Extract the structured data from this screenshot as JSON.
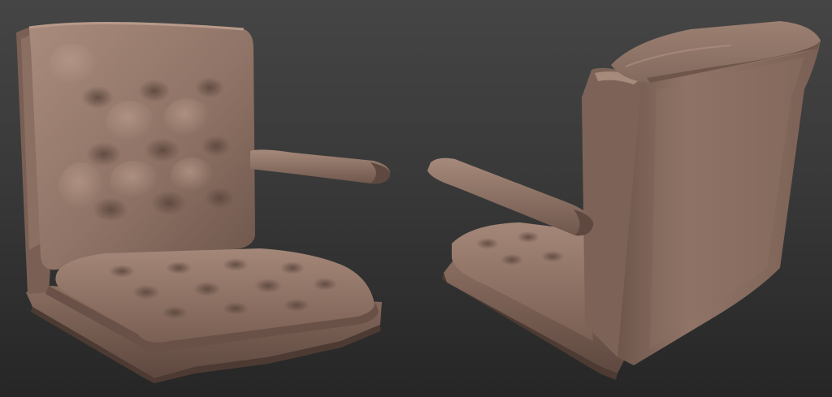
{
  "scene": {
    "description_visible_text": "",
    "background": {
      "top": "#454545",
      "bottom": "#262626"
    },
    "material": {
      "clay_base": "#8b6f62",
      "clay_light": "#b09384",
      "clay_mid": "#7d6357",
      "clay_dark": "#4f3c34",
      "clay_shadow": "#3a2c26"
    },
    "objects": [
      "chair-front-view",
      "chair-back-view"
    ]
  }
}
